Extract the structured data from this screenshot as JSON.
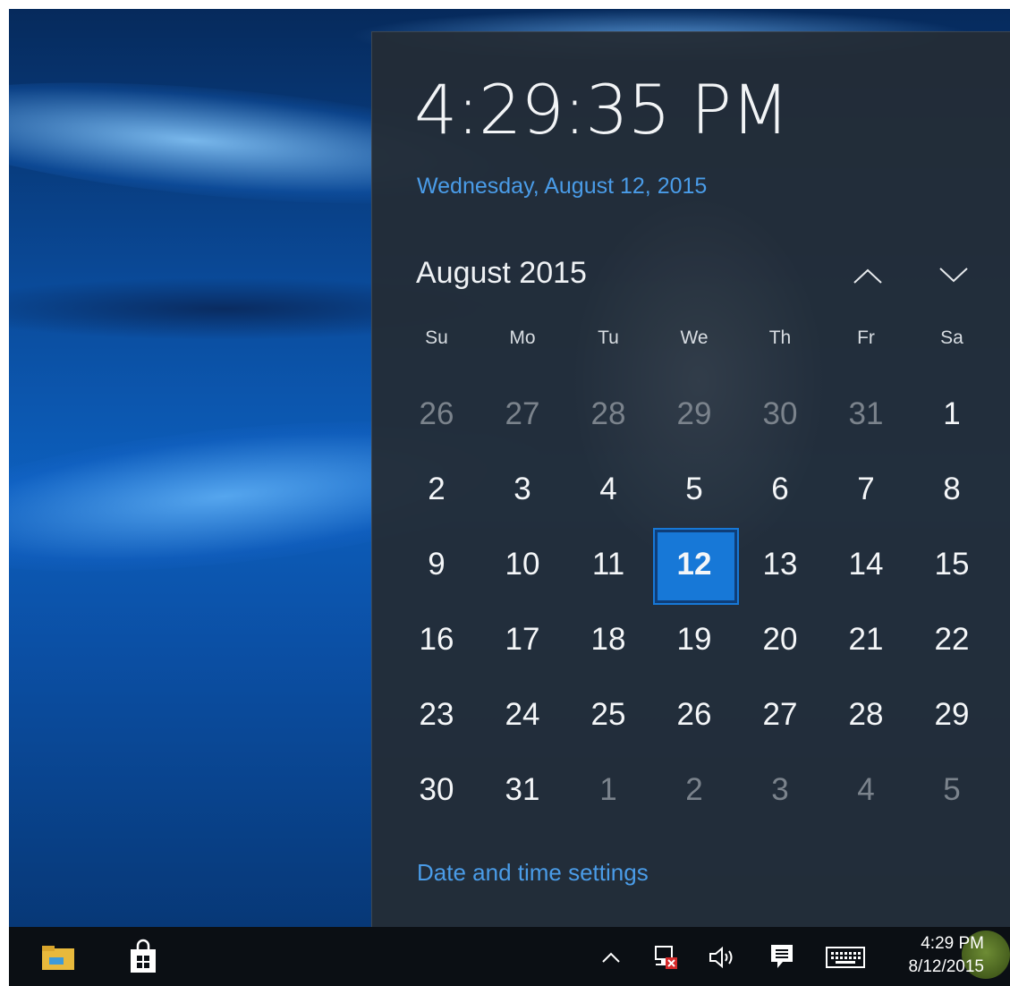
{
  "flyout": {
    "time": "4:29:35 PM",
    "long_date": "Wednesday, August 12, 2015",
    "month_title": "August 2015",
    "prev_icon": "chevron-up-icon",
    "next_icon": "chevron-down-icon",
    "weekdays": [
      "Su",
      "Mo",
      "Tu",
      "We",
      "Th",
      "Fr",
      "Sa"
    ],
    "weeks": [
      [
        "26",
        "27",
        "28",
        "29",
        "30",
        "31",
        "1"
      ],
      [
        "2",
        "3",
        "4",
        "5",
        "6",
        "7",
        "8"
      ],
      [
        "9",
        "10",
        "11",
        "12",
        "13",
        "14",
        "15"
      ],
      [
        "16",
        "17",
        "18",
        "19",
        "20",
        "21",
        "22"
      ],
      [
        "23",
        "24",
        "25",
        "26",
        "27",
        "28",
        "29"
      ],
      [
        "30",
        "31",
        "1",
        "2",
        "3",
        "4",
        "5"
      ]
    ],
    "muted_days": [
      [
        0,
        0
      ],
      [
        0,
        1
      ],
      [
        0,
        2
      ],
      [
        0,
        3
      ],
      [
        0,
        4
      ],
      [
        0,
        5
      ],
      [
        5,
        2
      ],
      [
        5,
        3
      ],
      [
        5,
        4
      ],
      [
        5,
        5
      ],
      [
        5,
        6
      ]
    ],
    "today": [
      2,
      3
    ],
    "settings_link": "Date and time settings"
  },
  "taskbar": {
    "pinned": [
      "file-explorer-icon",
      "store-icon"
    ],
    "tray_icons": [
      "show-hidden-icons-chevron",
      "network-disconnected-icon",
      "volume-icon",
      "action-center-icon",
      "touch-keyboard-icon"
    ],
    "clock_time": "4:29 PM",
    "clock_date": "8/12/2015"
  },
  "colors": {
    "accent": "#1778d7",
    "link": "#4a9ce8",
    "flyout_bg": "#242c36",
    "taskbar_bg": "#0b0f14"
  }
}
